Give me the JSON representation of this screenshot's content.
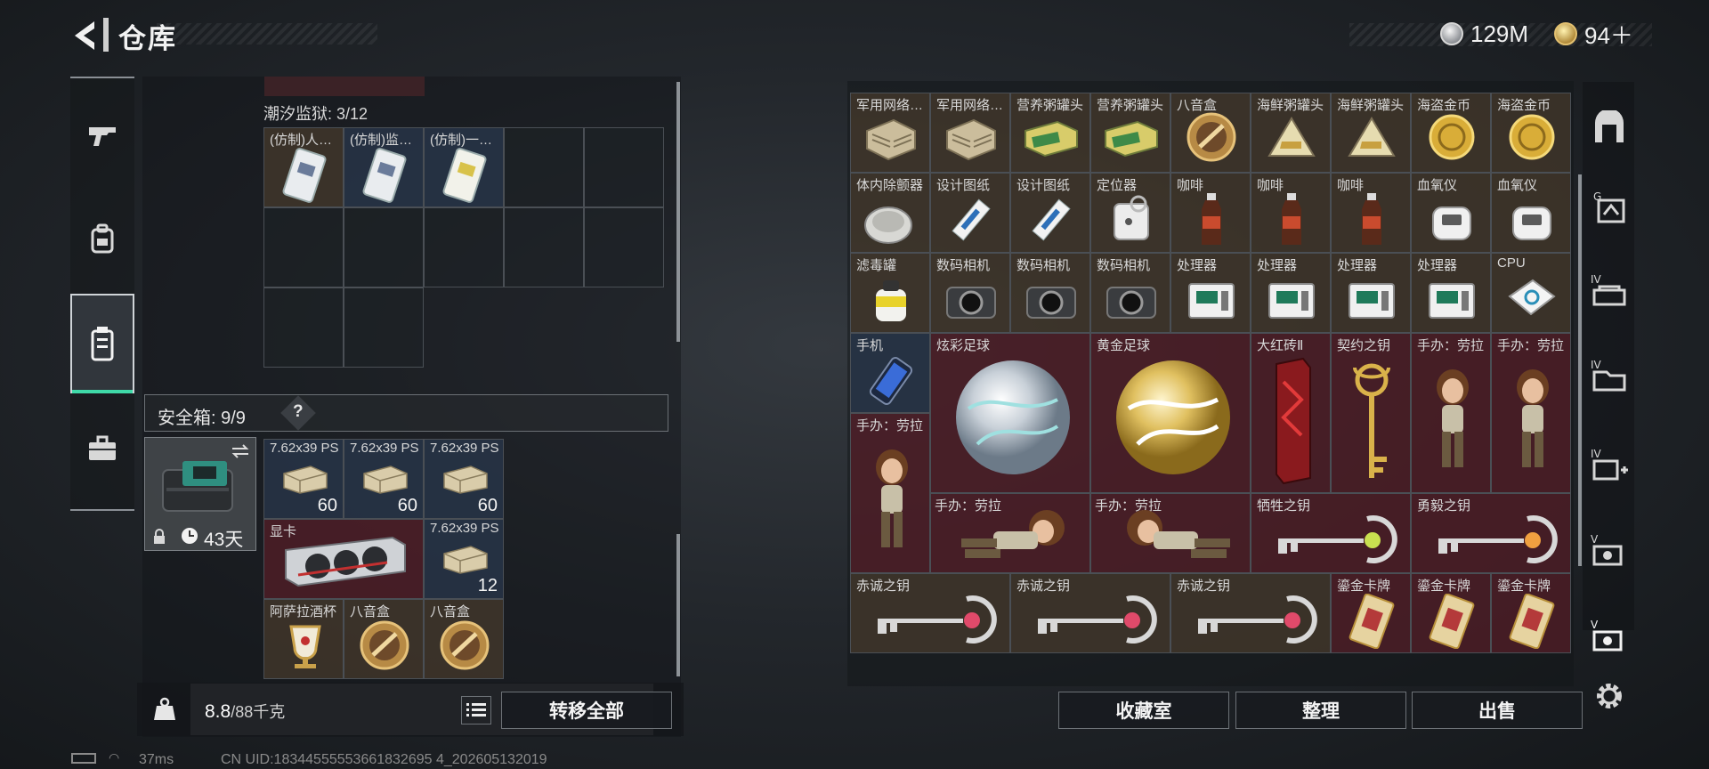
{
  "header": {
    "title": "仓库",
    "currency1": "129M",
    "currency2": "94＋"
  },
  "left_nav": [
    "gun-icon",
    "backpack-icon",
    "rig-icon",
    "case-icon"
  ],
  "left": {
    "tide_label": "潮汐监狱: 3/12",
    "tide_items": [
      {
        "label": "(仿制)人…",
        "bg": "brown"
      },
      {
        "label": "(仿制)监…",
        "bg": "blue"
      },
      {
        "label": "(仿制)一…",
        "bg": "blue"
      }
    ],
    "safebox_label": "安全箱: 9/9",
    "safebox_help": "?",
    "safebox_days": "43天",
    "safebox_items": [
      {
        "label": "7.62x39 PS",
        "qty": "60"
      },
      {
        "label": "7.62x39 PS",
        "qty": "60"
      },
      {
        "label": "7.62x39 PS",
        "qty": "60"
      },
      {
        "label": "显卡",
        "qty": ""
      },
      {
        "label": "7.62x39 PS",
        "qty": "12"
      },
      {
        "label": "阿萨拉酒杯",
        "qty": ""
      },
      {
        "label": "八音盒",
        "qty": ""
      },
      {
        "label": "八音盒",
        "qty": ""
      }
    ],
    "weight_value": "8.8",
    "weight_max": "/88千克",
    "transfer_all": "转移全部"
  },
  "right": {
    "row1": [
      "军用网络…",
      "军用网络…",
      "营养粥罐头",
      "营养粥罐头",
      "八音盒",
      "海鲜粥罐头",
      "海鲜粥罐头",
      "海盗金币",
      "海盗金币"
    ],
    "row2": [
      "体内除颤器",
      "设计图纸",
      "设计图纸",
      "定位器",
      "咖啡",
      "咖啡",
      "咖啡",
      "血氧仪",
      "血氧仪"
    ],
    "row3": [
      "滤毒罐",
      "数码相机",
      "数码相机",
      "数码相机",
      "处理器",
      "处理器",
      "处理器",
      "处理器",
      "CPU"
    ],
    "row4_phone": "手机",
    "row4_ball1": "炫彩足球",
    "row4_ball2": "黄金足球",
    "row4_brick": "大红砖Ⅱ",
    "row4_contract": "契约之钥",
    "row4_fig1": "手办：劳拉",
    "row4_fig2": "手办：劳拉",
    "row5_fig": "手办：劳拉",
    "row6_fig1": "手办：劳拉",
    "row6_fig2": "手办：劳拉",
    "row6_key1": "牺牲之钥",
    "row6_key2": "勇毅之钥",
    "row7_keys": [
      "赤诚之钥",
      "赤诚之钥",
      "赤诚之钥"
    ],
    "row7_cards": [
      "鎏金卡牌",
      "鎏金卡牌",
      "鎏金卡牌"
    ],
    "btn_collection": "收藏室",
    "btn_sort": "整理",
    "btn_sell": "出售"
  },
  "right_nav": [
    "exit-icon",
    "tab-g",
    "tab-iv-a",
    "tab-iv-b",
    "tab-iv-c",
    "tab-v-a",
    "tab-v-b"
  ],
  "status": {
    "ping": "37ms",
    "uid": "CN UID:18344555553661832695 4_202605132019"
  },
  "colors": {
    "accent": "#3fd9a8",
    "brown_cell": "#463a2c",
    "red_cell": "#581e28",
    "blue_cell": "#28364a"
  }
}
